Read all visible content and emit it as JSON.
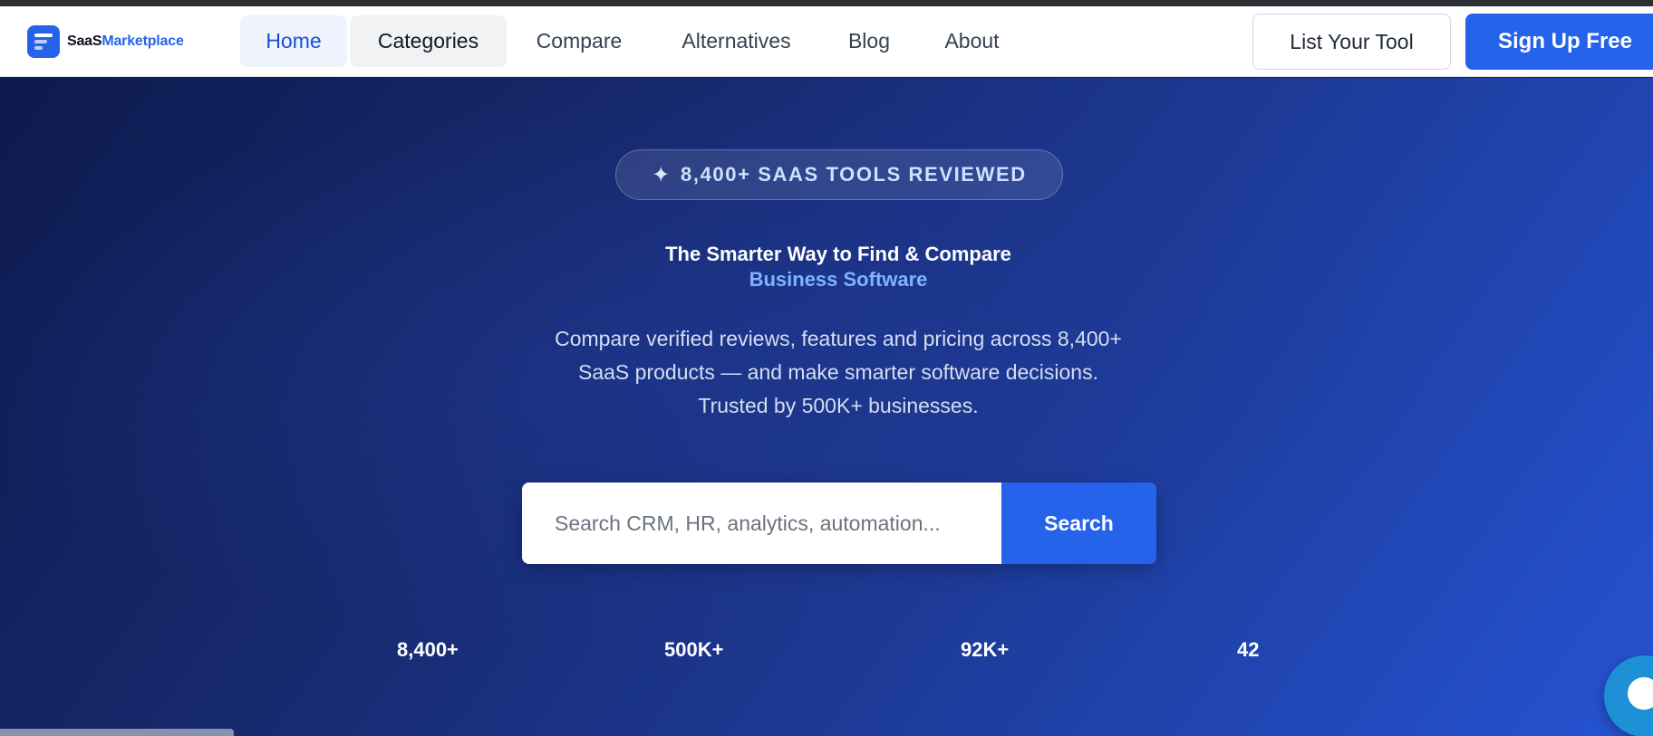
{
  "brand": {
    "name_part1": "SaaS",
    "name_part2": "Marketplace",
    "accent_color": "#2563eb"
  },
  "nav": {
    "items": [
      {
        "label": "Home",
        "active": true
      },
      {
        "label": "Categories"
      },
      {
        "label": "Compare"
      },
      {
        "label": "Alternatives"
      },
      {
        "label": "Blog"
      },
      {
        "label": "About"
      }
    ],
    "list_tool_label": "List Your Tool",
    "signup_label": "Sign Up Free"
  },
  "hero": {
    "badge_icon": "sparkle-icon",
    "badge": "8,400+ SAAS TOOLS REVIEWED",
    "title_line1": "The Smarter Way to Find & Compare",
    "title_line2": "Business Software",
    "description": "Compare verified reviews, features and pricing across 8,400+ SaaS products — and make smarter software decisions. Trusted by 500K+ businesses."
  },
  "search": {
    "placeholder": "Search CRM, HR, analytics, automation...",
    "value": "",
    "button_label": "Search"
  },
  "stats": [
    {
      "value": "8,400+"
    },
    {
      "value": "500K+"
    },
    {
      "value": "92K+"
    },
    {
      "value": "42"
    }
  ],
  "widgets": {
    "chat_icon": "chat-bubble-icon"
  }
}
